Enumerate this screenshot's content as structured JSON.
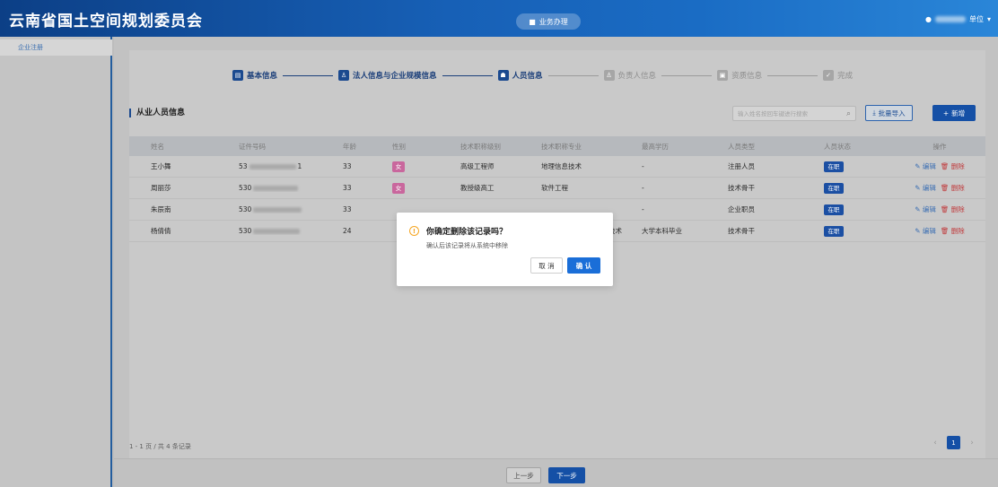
{
  "header": {
    "title": "云南省国土空间规划委员会",
    "biz_button": "业务办理",
    "user_suffix": "单位"
  },
  "sidebar": {
    "items": [
      {
        "label": "企业注册"
      }
    ]
  },
  "steps": [
    {
      "label": "基本信息",
      "icon": "document-icon",
      "state": "done"
    },
    {
      "label": "法人信息与企业规模信息",
      "icon": "person-icon",
      "state": "done"
    },
    {
      "label": "人员信息",
      "icon": "people-icon",
      "state": "active"
    },
    {
      "label": "负责人信息",
      "icon": "person-icon",
      "state": "inactive"
    },
    {
      "label": "资质信息",
      "icon": "certificate-icon",
      "state": "inactive"
    },
    {
      "label": "完成",
      "icon": "check-icon",
      "state": "inactive"
    }
  ],
  "section": {
    "title": "从业人员信息",
    "search_placeholder": "输入姓名按回车键进行搜索",
    "import_label": "批量导入",
    "add_label": "新增"
  },
  "table": {
    "columns": [
      "姓名",
      "证件号码",
      "年龄",
      "性别",
      "技术职称级别",
      "技术职称专业",
      "最高学历",
      "人员类型",
      "人员状态",
      "操作"
    ],
    "rows": [
      {
        "name": "王小舞",
        "id_prefix": "53",
        "id_suffix": "1",
        "age": "33",
        "gender": "女",
        "title_level": "高级工程师",
        "title_major": "地理信息技术",
        "education": "-",
        "type": "注册人员",
        "status": "在职"
      },
      {
        "name": "周丽莎",
        "id_prefix": "530",
        "id_suffix": "",
        "age": "33",
        "gender": "女",
        "title_level": "教授级高工",
        "title_major": "软件工程",
        "education": "-",
        "type": "技术骨干",
        "status": "在职"
      },
      {
        "name": "朱辰南",
        "id_prefix": "530",
        "id_suffix": "",
        "age": "33",
        "gender": "",
        "title_level": "",
        "title_major": "",
        "education": "-",
        "type": "企业职员",
        "status": "在职"
      },
      {
        "name": "杨倩倩",
        "id_prefix": "530",
        "id_suffix": "",
        "age": "24",
        "gender": "",
        "title_level": "",
        "title_major": "技术",
        "education": "大学本科毕业",
        "type": "技术骨干",
        "status": "在职"
      }
    ],
    "op_edit": "编辑",
    "op_delete": "删除"
  },
  "footer": {
    "count": "1 - 1 页 / 共 4 条记录",
    "current_page": "1",
    "prev_label": "上一步",
    "next_label": "下一步"
  },
  "dialog": {
    "title": "你确定删除该记录吗？",
    "message": "确认后该记录将从系统中移除",
    "cancel": "取 消",
    "confirm": "确 认"
  }
}
